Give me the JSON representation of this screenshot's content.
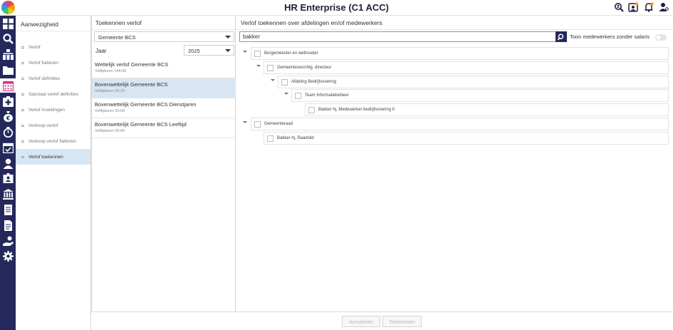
{
  "app": {
    "title": "HR Enterprise (C1 ACC)"
  },
  "top_icons": [
    "search-user-icon",
    "refresh-user-icon",
    "bell-icon",
    "user-settings-icon"
  ],
  "rail_icons": [
    "grid-icon",
    "search-icon",
    "org-chart-icon",
    "folder-icon",
    "calendar-icon",
    "medical-icon",
    "money-bag-icon",
    "timer-icon",
    "calendar-check-icon",
    "user-icon",
    "id-card-icon",
    "bank-icon",
    "document-icon",
    "document-list-icon",
    "hand-user-icon",
    "gear-icon"
  ],
  "submenu": {
    "title": "Aanwezigheid",
    "items": [
      {
        "label": "Verlof"
      },
      {
        "label": "Verlof fiatteren"
      },
      {
        "label": "Verlof definities"
      },
      {
        "label": "Speciaal verlof definities"
      },
      {
        "label": "Verlof instellingen"
      },
      {
        "label": "Verkoop verlof"
      },
      {
        "label": "Verkoop verlof fiatteren"
      },
      {
        "label": "Verlof toekennen"
      }
    ],
    "active_index": 7
  },
  "middle": {
    "header": "Toekennen verlof",
    "scheme_select": {
      "value": "Gemeente BCS"
    },
    "year_label": "Jaar",
    "year_select": {
      "value": "2025"
    },
    "leave_types": [
      {
        "name": "Wettelijk verlof Gemeente BCS",
        "sub": "Volltjduren 144:00"
      },
      {
        "name": "Bovenwettelijk Gemeente BCS",
        "sub": "Volltijduren 50:24"
      },
      {
        "name": "Bovenwettelijk Gemeente BCS Dienstjaren",
        "sub": "Volltijduren 00:00"
      },
      {
        "name": "Bovenwettelijk Gemeente BCS Leeftijd",
        "sub": "Volltijduren 00:00"
      }
    ],
    "selected_index": 1
  },
  "right": {
    "header": "Verlof toekennen over afdelingen en/of medewerkers",
    "search": {
      "value": "bakker"
    },
    "toggle_label": "Toon medewerkers zonder salaris",
    "tree": [
      {
        "label": "Burgemeester en wethouder",
        "level": 0,
        "expanded": true
      },
      {
        "label": "Gemeentesecr/Alg. directeur",
        "level": 1,
        "expanded": true
      },
      {
        "label": "Afdeling Bedrijfsvoering",
        "level": 2,
        "expanded": true
      },
      {
        "label": "Team Informatiebeheer",
        "level": 3,
        "expanded": true
      },
      {
        "label": "Bakker hj, Medewerker bedrijfsvoering II",
        "level": 4,
        "expanded": false
      },
      {
        "label": "Gemeenteraad",
        "level": 0,
        "expanded": true
      },
      {
        "label": "Bakker hj, Raadslid",
        "level": 1,
        "expanded": false
      }
    ]
  },
  "footer": {
    "cancel_label": "Annuleren",
    "grant_label": "Toekennen"
  },
  "colors": {
    "rail": "#24285a",
    "selected": "#d7e6f2",
    "accent_calendar": "#d63384"
  }
}
